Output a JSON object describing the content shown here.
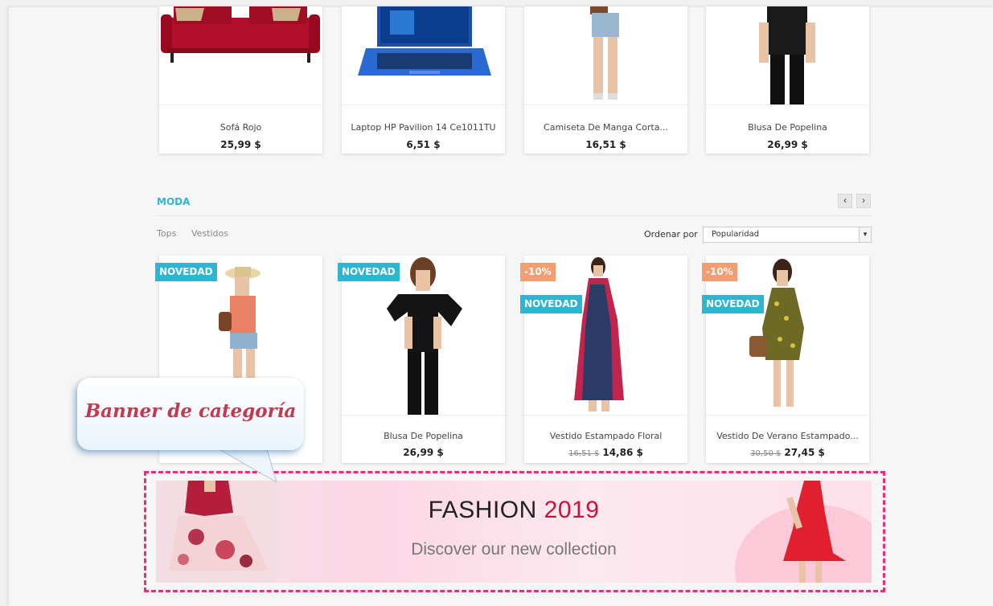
{
  "top_products": [
    {
      "name": "Sofá Rojo",
      "price": "25,99 $"
    },
    {
      "name": "Laptop HP Pavilion 14 Ce1011TU",
      "price": "6,51 $"
    },
    {
      "name": "Camiseta De Manga Corta...",
      "price": "16,51 $"
    },
    {
      "name": "Blusa De Popelina",
      "price": "26,99 $"
    }
  ],
  "section": {
    "title": "MODA",
    "prev_icon": "‹",
    "next_icon": "›",
    "tabs": [
      "Tops",
      "Vestidos"
    ],
    "sort_label": "Ordenar por",
    "sort_value": "Popularidad"
  },
  "products": [
    {
      "name": "",
      "price": "",
      "old_price": "",
      "badges": [
        "NOVEDAD"
      ]
    },
    {
      "name": "Blusa De Popelina",
      "price": "26,99 $",
      "old_price": "",
      "badges": [
        "NOVEDAD"
      ]
    },
    {
      "name": "Vestido Estampado Floral",
      "price": "14,86 $",
      "old_price": "16,51 $",
      "badges": [
        "-10%",
        "NOVEDAD"
      ]
    },
    {
      "name": "Vestido De Verano Estampado...",
      "price": "27,45 $",
      "old_price": "30,50 $",
      "badges": [
        "-10%",
        "NOVEDAD"
      ]
    }
  ],
  "banner": {
    "title": "FASHION",
    "year": "2019",
    "subtitle": "Discover our new collection"
  },
  "callout": {
    "text": "Banner de categoría"
  },
  "colors": {
    "accent": "#2fb5d2",
    "sale": "#f39d72",
    "highlight": "#e5317d",
    "banner_year": "#c4163c"
  }
}
